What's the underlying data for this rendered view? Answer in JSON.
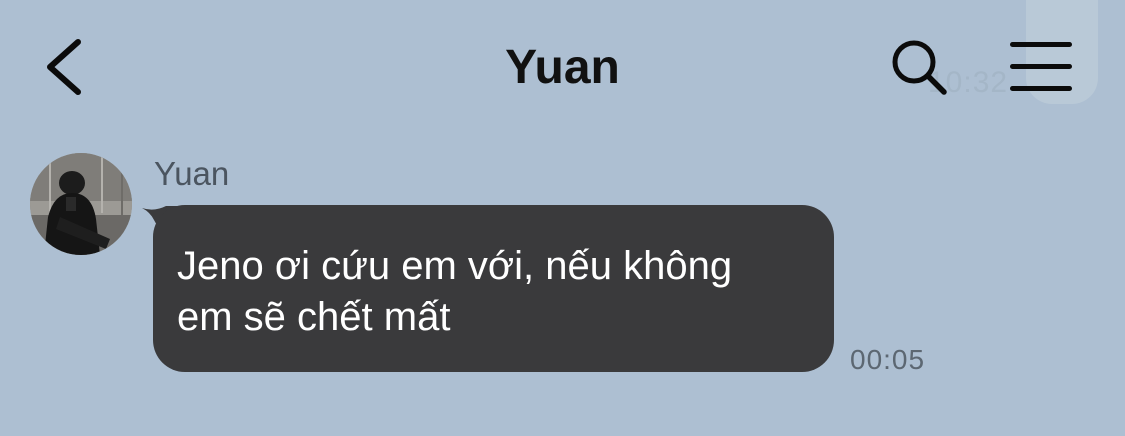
{
  "header": {
    "title": "Yuan",
    "back_icon": "chevron-left-icon",
    "search_icon": "search-icon",
    "menu_icon": "hamburger-menu-icon",
    "ghost_time": "10:32"
  },
  "message": {
    "sender_name": "Yuan",
    "text_line1": "Jeno ơi cứu em với, nếu không",
    "text_line2": "em sẽ chết mất",
    "time": "00:05"
  },
  "colors": {
    "background": "#adbfd2",
    "bubble": "#3a3a3c",
    "bubble_text": "#ffffff",
    "title_text": "#111111",
    "meta_text": "#5c6772"
  }
}
